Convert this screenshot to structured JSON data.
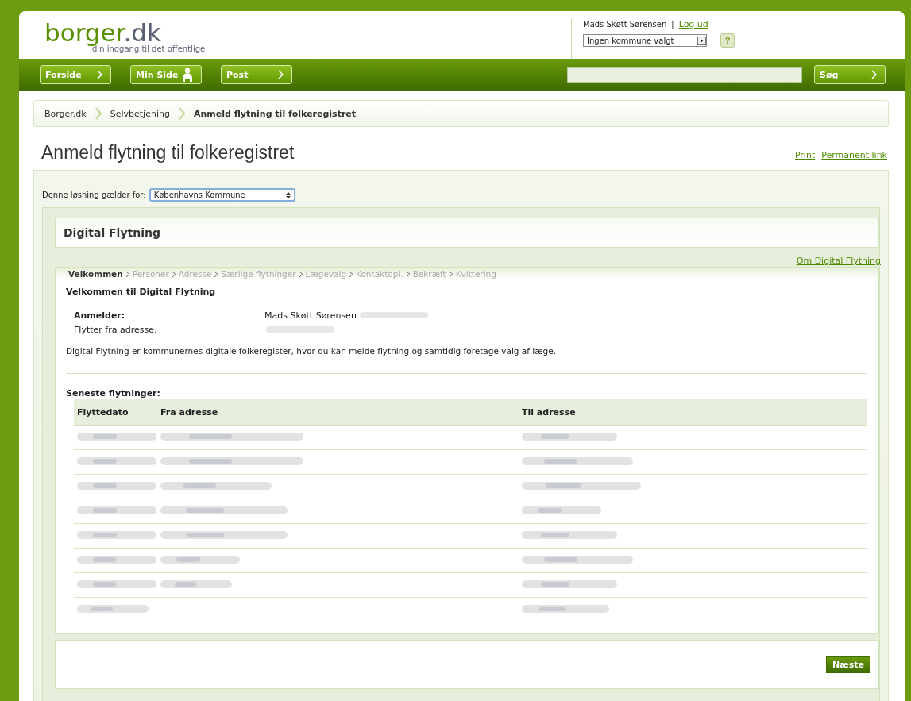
{
  "header": {
    "logo": {
      "part_1": "borger",
      "part_2": ".dk",
      "tagline": "din indgang til det offentlige"
    },
    "user": {
      "name": "Mads Skøtt Sørensen",
      "separator": "|",
      "logout": "Log ud"
    },
    "municipality_select": {
      "value": "Ingen kommune valgt"
    },
    "help_button": {
      "label": "?"
    }
  },
  "nav": {
    "buttons": [
      {
        "label": "Forside",
        "kind": "arrow"
      },
      {
        "label": "Min Side",
        "kind": "person"
      },
      {
        "label": "Post",
        "kind": "arrow"
      }
    ],
    "search_button": {
      "label": "Søg"
    }
  },
  "breadcrumb": [
    {
      "label": "Borger.dk",
      "current": false
    },
    {
      "label": "Selvbetjening",
      "current": false
    },
    {
      "label": "Anmeld flytning til folkeregistret",
      "current": true
    }
  ],
  "page": {
    "title": "Anmeld flytning til folkeregistret",
    "links": [
      "Print",
      "Permanent link"
    ]
  },
  "solution": {
    "label": "Denne løsning gælder for:",
    "select": "Københavns Kommune"
  },
  "app": {
    "title": "Digital Flytning",
    "about_link": "Om Digital Flytning",
    "steps": [
      {
        "label": "Velkommen",
        "selected": true
      },
      {
        "label": "Personer",
        "selected": false
      },
      {
        "label": "Adresse",
        "selected": false
      },
      {
        "label": "Særlige flytninger",
        "selected": false
      },
      {
        "label": "Lægevalg",
        "selected": false
      },
      {
        "label": "Kontaktopl.",
        "selected": false
      },
      {
        "label": "Bekræft",
        "selected": false
      },
      {
        "label": "Kvittering",
        "selected": false
      }
    ],
    "heading": "Velkommen til Digital Flytning",
    "fields": [
      {
        "label": "Anmelder:",
        "value": "Mads Skøtt Sørensen",
        "kind": "bold",
        "redacted": true
      },
      {
        "label": "Flytter fra adresse:",
        "kind": "plain",
        "redacted": true
      }
    ],
    "intro": "Digital Flytning er kommunernes digitale folkeregister, hvor du kan melde flytning og samtidig foretage valg af læge.",
    "moves": {
      "title": "Seneste flytninger:",
      "columns": [
        "Flyttedato",
        "Fra adresse",
        "Til adresse"
      ],
      "rows": [
        {
          "kind": "redacted"
        },
        {
          "kind": "redacted"
        },
        {
          "kind": "redacted"
        },
        {
          "kind": "redacted"
        },
        {
          "kind": "redacted"
        },
        {
          "kind": "redacted"
        },
        {
          "kind": "redacted"
        },
        {
          "kind": "redacted_partial"
        }
      ]
    },
    "next_button": "Næste"
  }
}
